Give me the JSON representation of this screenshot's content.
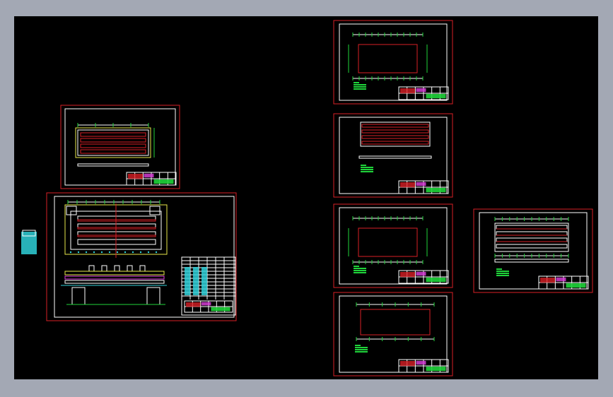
{
  "viewer": {
    "background": "#000000",
    "frame_color": "#a3a8b4"
  },
  "colors": {
    "border": "#d81f26",
    "inner": "#ffffff",
    "green": "#1fd43a",
    "yellow": "#e8e84a",
    "cyan": "#2fd0d8",
    "magenta": "#e040e0"
  },
  "sheets": [
    {
      "id": "sheet-small-panel",
      "kind": "panel"
    },
    {
      "id": "sheet-assembly",
      "kind": "assembly"
    },
    {
      "id": "sheet-top-1",
      "kind": "grid"
    },
    {
      "id": "sheet-top-2",
      "kind": "stripes"
    },
    {
      "id": "sheet-top-3",
      "kind": "grid"
    },
    {
      "id": "sheet-top-4",
      "kind": "plain"
    },
    {
      "id": "sheet-right",
      "kind": "stripes-grid"
    }
  ]
}
